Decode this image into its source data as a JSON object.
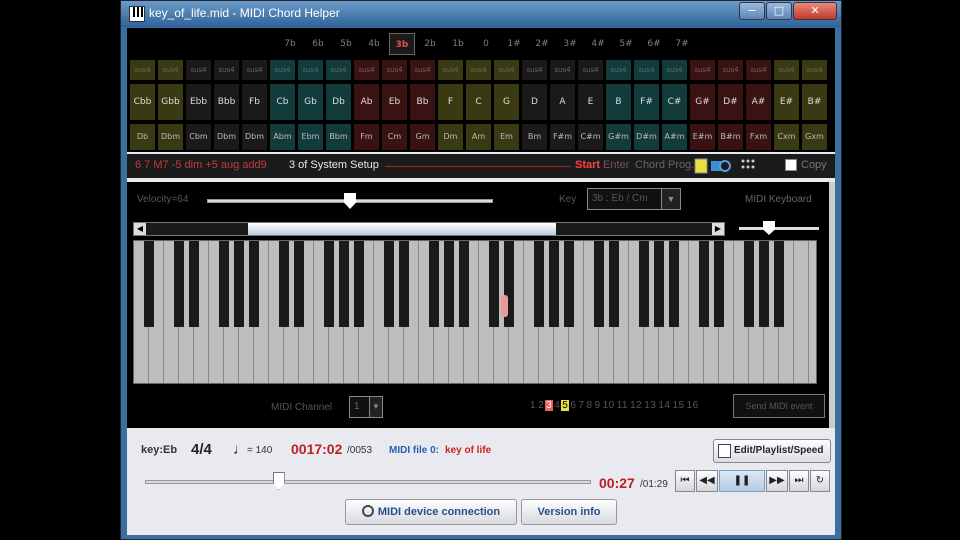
{
  "window": {
    "title": "key_of_life.mid - MIDI Chord Helper",
    "min_label": "−",
    "max_label": "□",
    "close_label": "✕"
  },
  "key_signatures": [
    "7b",
    "6b",
    "5b",
    "4b",
    "3b",
    "2b",
    "1b",
    "0",
    "1#",
    "2#",
    "3#",
    "4#",
    "5#",
    "6#",
    "7#"
  ],
  "selected_key_signature": "3b",
  "chord_columns": [
    {
      "m": "Cbb",
      "b": "Db",
      "s": "sus4",
      "c": "#3a3a12"
    },
    {
      "m": "Gbb",
      "b": "Dbm",
      "s": "sus4",
      "c": "#3a3a12"
    },
    {
      "m": "Ebb",
      "b": "Cbm",
      "s": "sus4",
      "c": "#1a1a1a"
    },
    {
      "m": "Bbb",
      "b": "Dbm",
      "s": "sus4",
      "c": "#1a1a1a"
    },
    {
      "m": "Fb",
      "b": "Dbm",
      "s": "sus4",
      "c": "#1a1a1a"
    },
    {
      "m": "Cb",
      "b": "Abm",
      "s": "sus4",
      "c": "#123b3b"
    },
    {
      "m": "Gb",
      "b": "Ebm",
      "s": "sus4",
      "c": "#123b3b"
    },
    {
      "m": "Db",
      "b": "Bbm",
      "s": "sus4",
      "c": "#123b3b"
    },
    {
      "m": "Ab",
      "b": "Fm",
      "s": "sus4",
      "c": "#3b1212"
    },
    {
      "m": "Eb",
      "b": "Cm",
      "s": "sus4",
      "c": "#3b1212"
    },
    {
      "m": "Bb",
      "b": "Gm",
      "s": "sus4",
      "c": "#3b1212"
    },
    {
      "m": "F",
      "b": "Dm",
      "s": "sus4",
      "c": "#3a3a12"
    },
    {
      "m": "C",
      "b": "Am",
      "s": "sus4",
      "c": "#3a3a12"
    },
    {
      "m": "G",
      "b": "Em",
      "s": "sus4",
      "c": "#3a3a12"
    },
    {
      "m": "D",
      "b": "Bm",
      "s": "sus4",
      "c": "#1a1a1a"
    },
    {
      "m": "A",
      "b": "F#m",
      "s": "sus4",
      "c": "#1a1a1a"
    },
    {
      "m": "E",
      "b": "C#m",
      "s": "sus4",
      "c": "#1a1a1a"
    },
    {
      "m": "B",
      "b": "G#m",
      "s": "sus4",
      "c": "#123b3b"
    },
    {
      "m": "F#",
      "b": "D#m",
      "s": "sus4",
      "c": "#123b3b"
    },
    {
      "m": "C#",
      "b": "A#m",
      "s": "sus4",
      "c": "#123b3b"
    },
    {
      "m": "G#",
      "b": "E#m",
      "s": "sus4",
      "c": "#3b1212"
    },
    {
      "m": "D#",
      "b": "B#m",
      "s": "sus4",
      "c": "#3b1212"
    },
    {
      "m": "A#",
      "b": "Fxm",
      "s": "sus4",
      "c": "#3b1212"
    },
    {
      "m": "E#",
      "b": "Cxm",
      "s": "sus4",
      "c": "#3a3a12"
    },
    {
      "m": "B#",
      "b": "Gxm",
      "s": "sus4",
      "c": "#3a3a12"
    }
  ],
  "status": {
    "indicator": "6 7 M7 -5 dim +5 aug add9",
    "setup": "3 of System Setup",
    "start": "Start",
    "enter": "Enter",
    "chord_prog": "Chord Prog.",
    "copy": "Copy"
  },
  "keyboard": {
    "velocity_label": "Velocity=64",
    "velocity": 0.5,
    "key_label": "Key",
    "key_value": "3b : Eb / Cm",
    "midi_keyboard_label": "MIDI Keyboard",
    "midi_channel_label": "MIDI Channel",
    "channel_value": "1",
    "channels": [
      "1",
      "2",
      "3",
      "4",
      "5",
      "6",
      "7",
      "8",
      "9",
      "10",
      "11",
      "12",
      "13",
      "14",
      "15",
      "16"
    ],
    "channel_red": "3",
    "channel_yellow": "5",
    "send_label": "Send MIDI event"
  },
  "player": {
    "key": "key:Eb",
    "time_signature": "4/4",
    "note_symbol": "♩",
    "tempo": "= 140",
    "measure_now": "0017:02",
    "measure_total": "/0053",
    "midi_file_label": "MIDI file 0:",
    "midi_file_name": "key of life",
    "edit_label": "Edit/Playlist/Speed",
    "time_now": "00:27",
    "time_total": "/01:29",
    "seek": 0.3,
    "btn_top": "⏮",
    "btn_back": "◀◀",
    "btn_pause": "❚❚",
    "btn_fwd": "▶▶",
    "btn_bottom": "⏭",
    "btn_repeat": "↻",
    "device_label": "MIDI device connection",
    "version_label": "Version info"
  }
}
